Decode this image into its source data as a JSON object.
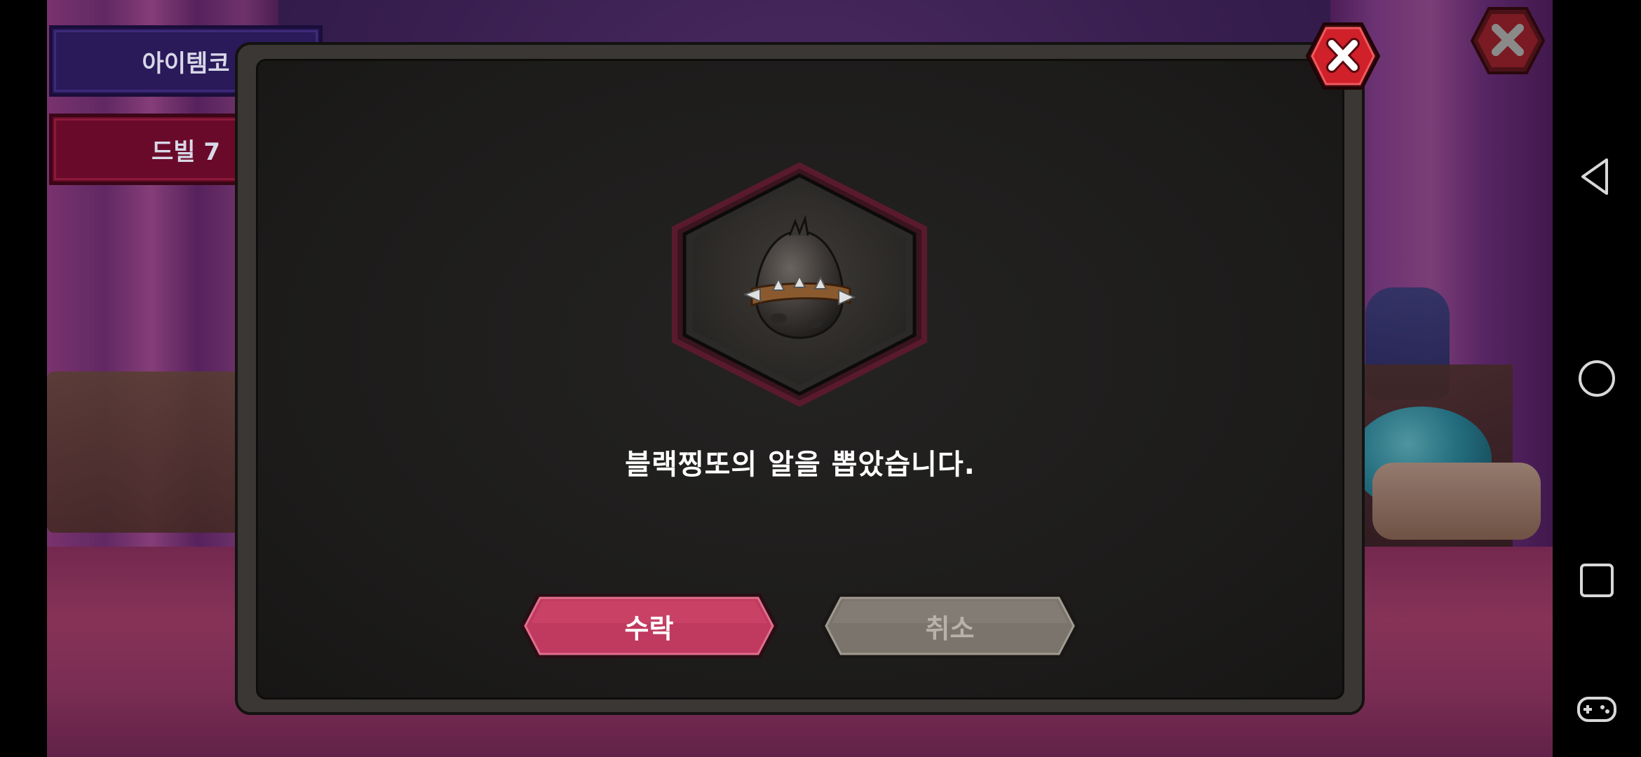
{
  "background_menu": {
    "item_code_label": "아이템코",
    "devil_label": "드빌 7"
  },
  "dialog": {
    "item_name": "블랙찡또의 알",
    "message": "블랙찡또의 알을 뽑았습니다.",
    "accept_label": "수락",
    "cancel_label": "취소"
  },
  "icons": {
    "close_modal": "close-icon",
    "close_background": "close-icon",
    "item": "spiked-egg-icon",
    "nav_back": "back-icon",
    "nav_home": "home-icon",
    "nav_recents": "recents-icon",
    "nav_game": "gamepad-icon"
  },
  "colors": {
    "accept": "#c0395e",
    "cancel": "#7a746c",
    "close_red": "#d0202a",
    "item_frame_border": "#5a1a2e"
  }
}
